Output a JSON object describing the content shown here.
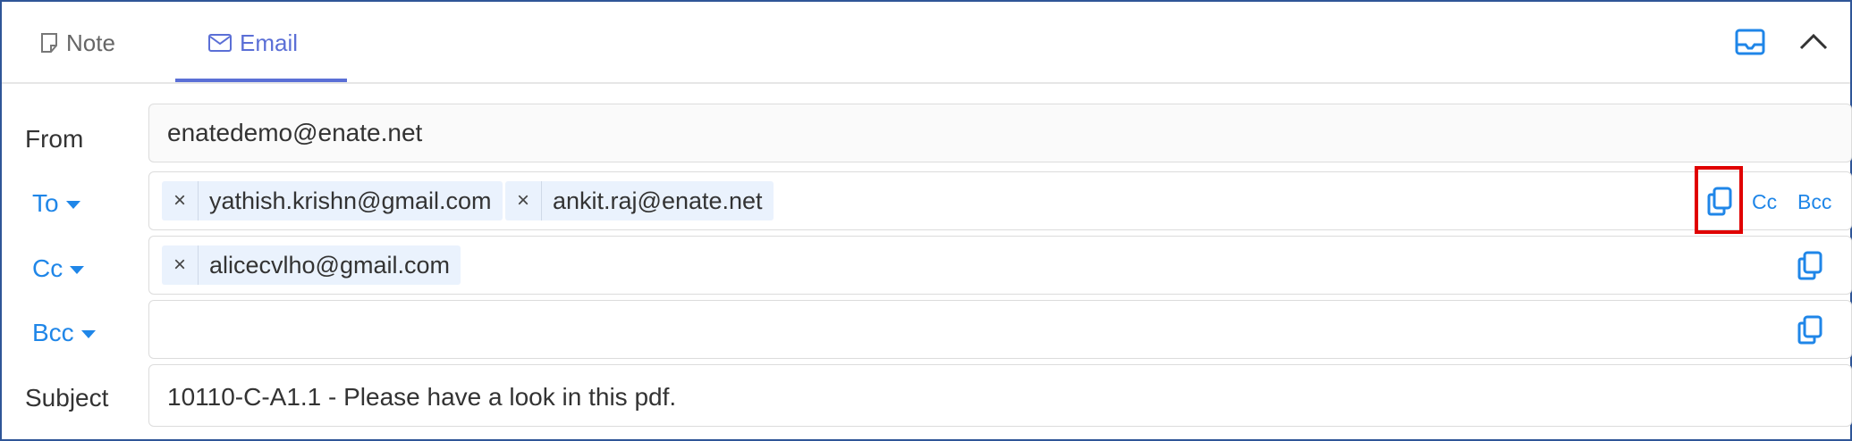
{
  "tabs": {
    "note": "Note",
    "email": "Email"
  },
  "labels": {
    "from": "From",
    "to": "To",
    "cc": "Cc",
    "bcc": "Bcc",
    "subject": "Subject"
  },
  "from_value": "enatedemo@enate.net",
  "to_recipients": [
    "yathish.krishn@gmail.com",
    "ankit.raj@enate.net"
  ],
  "cc_recipients": [
    "alicecvlho@gmail.com"
  ],
  "chip_remove": "×",
  "to_actions": {
    "cc": "Cc",
    "bcc": "Bcc"
  },
  "subject_value": "10110-C-A1.1 - Please have a look in this pdf.",
  "colors": {
    "accent": "#1f86e8",
    "tab_active": "#5b6fd6",
    "highlight": "#e00000",
    "frame": "#2f5597"
  }
}
